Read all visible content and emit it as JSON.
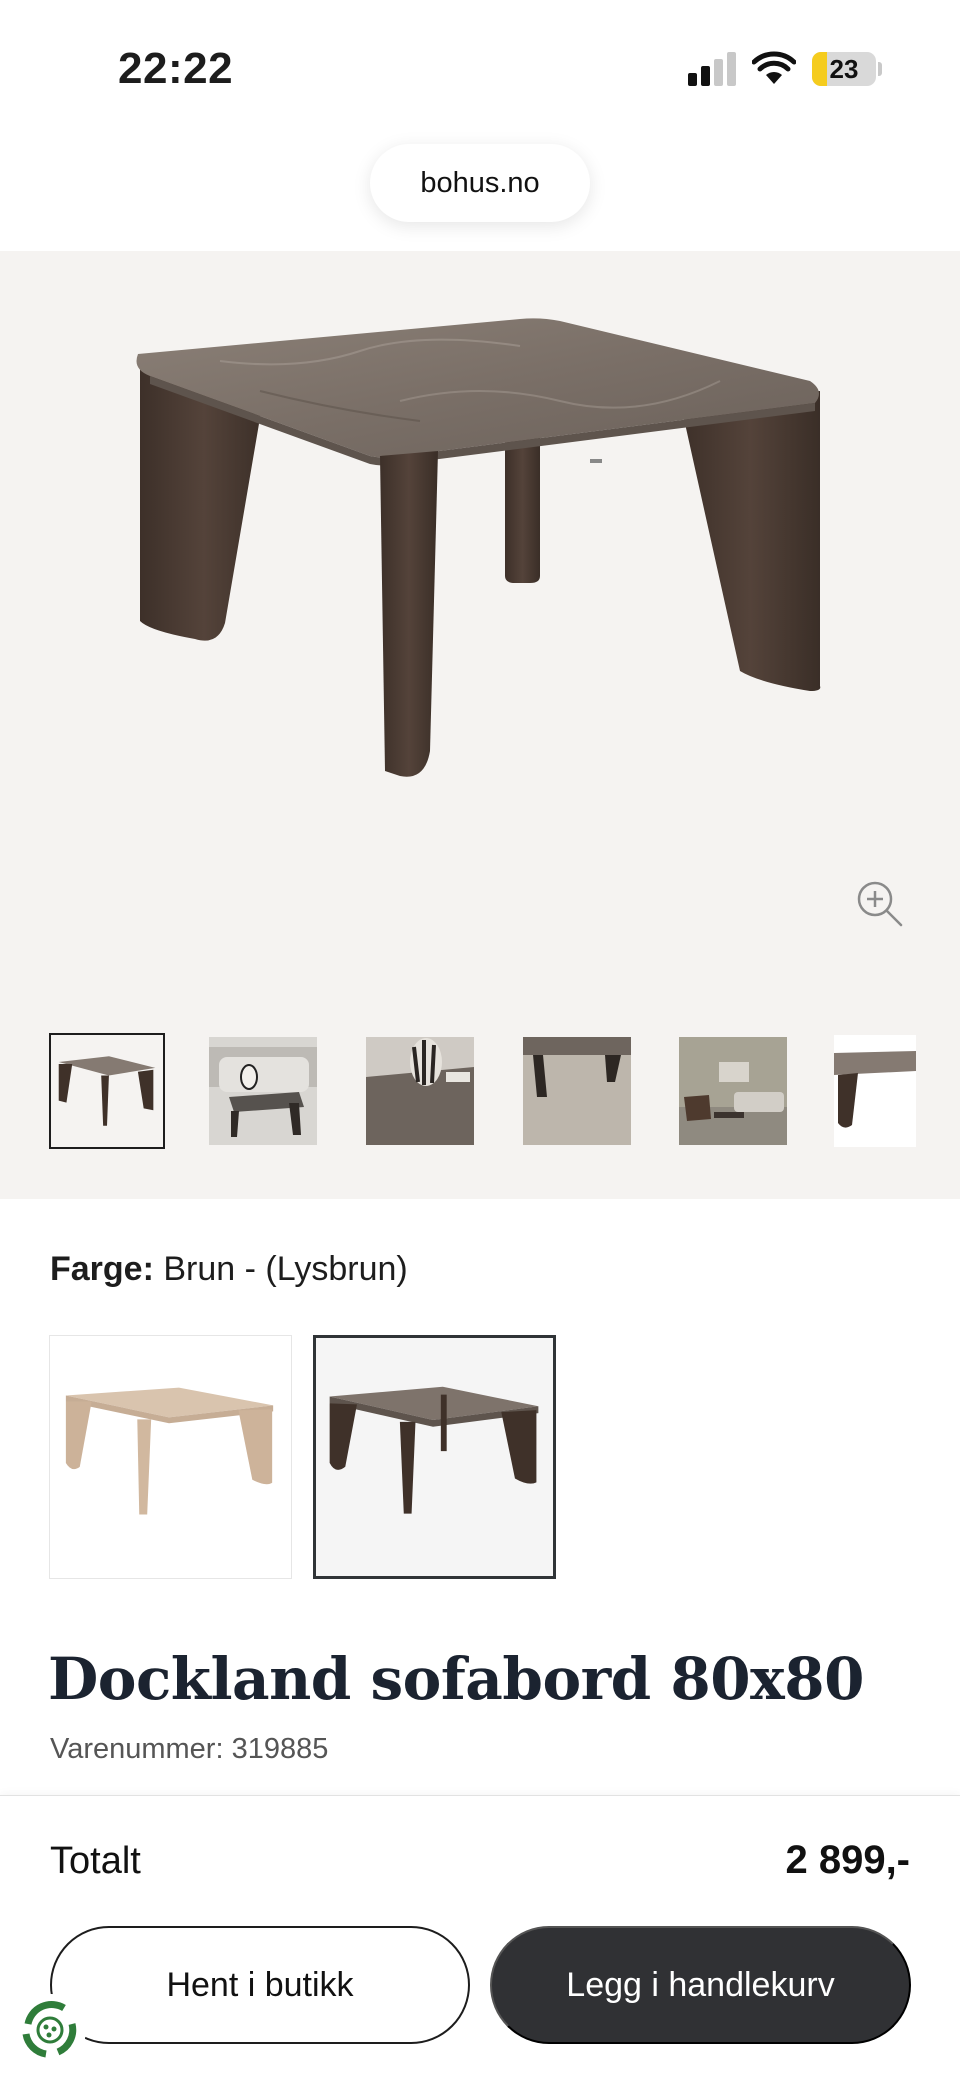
{
  "status_bar": {
    "time": "22:22",
    "battery_level": "23",
    "battery_color": "#f5cc1e"
  },
  "browser": {
    "url": "bohus.no"
  },
  "gallery": {
    "thumbnail_count": 6,
    "active_thumbnail": 1,
    "background": "#f5f3f1"
  },
  "color_selector": {
    "label": "Farge:",
    "value": "Brun - (Lysbrun)",
    "options": [
      "light-oak",
      "dark-brown-marble"
    ],
    "selected_index": 1
  },
  "product": {
    "title": "Dockland sofabord 80x80",
    "sku": "Varenummer: 319885"
  },
  "checkout": {
    "total_label": "Totalt",
    "total_price": "2 899,-",
    "store_button": "Hent i butikk",
    "cart_button": "Legg i handlekurv",
    "cart_button_color": "#303134"
  }
}
